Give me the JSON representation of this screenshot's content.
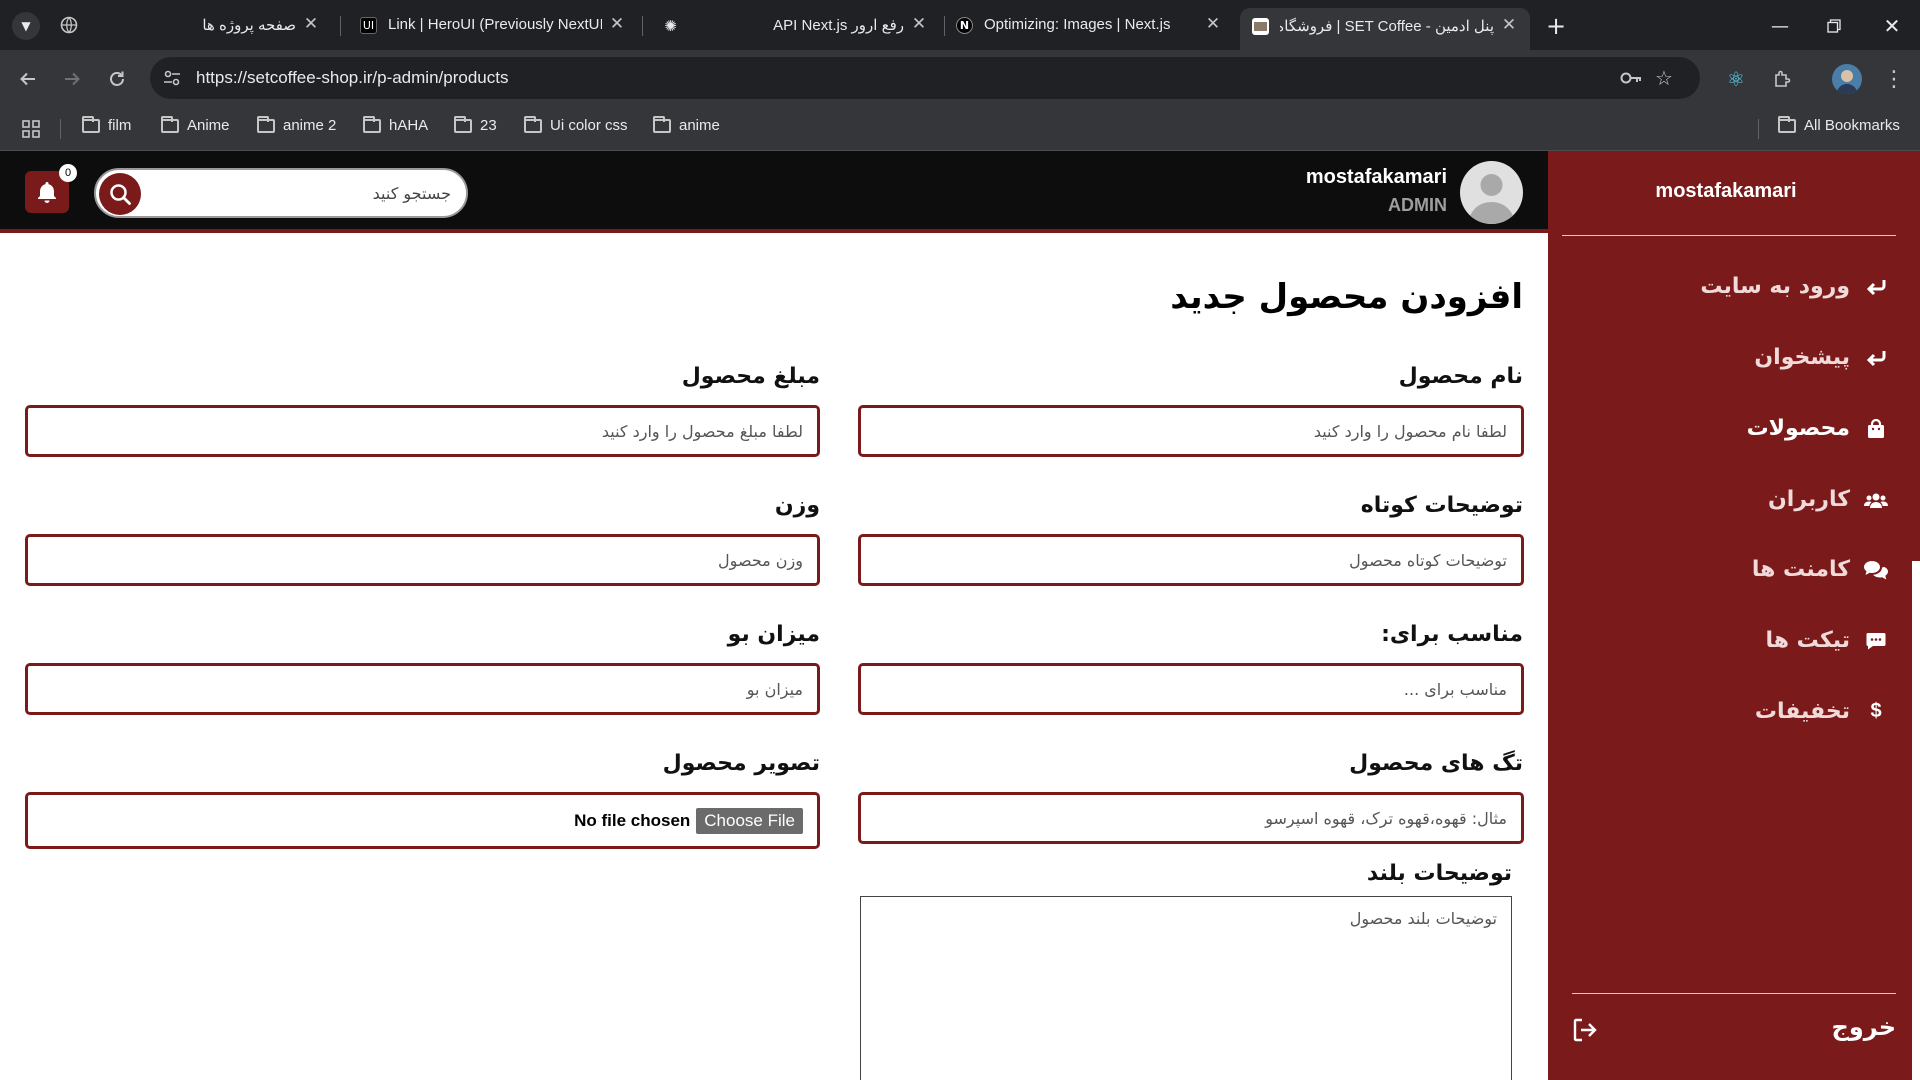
{
  "browser": {
    "tabs": [
      {
        "title": "صفحه پروژه ها",
        "favicon": "globe-icon",
        "rtl": true
      },
      {
        "title": "Link | HeroUI (Previously NextUI)",
        "favicon": "heroui-icon",
        "rtl": false
      },
      {
        "title": "رفع ارور API Next.js",
        "favicon": "chatgpt-icon",
        "rtl": true
      },
      {
        "title": "Optimizing: Images | Next.js",
        "favicon": "nextjs-icon",
        "rtl": false
      },
      {
        "title": "پنل ادمین - SET Coffee | فروشگاه",
        "favicon": "setcoffee-icon",
        "rtl": true,
        "active": true
      }
    ],
    "url": "https://setcoffee-shop.ir/p-admin/products",
    "bookmarks": [
      "film",
      "Anime",
      "anime 2",
      "hAHA",
      "23",
      "Ui color css",
      "anime"
    ],
    "all_bookmarks_label": "All Bookmarks"
  },
  "topbar": {
    "notification_count": "0",
    "search_placeholder": "جستجو کنید",
    "admin_name": "mostafakamari",
    "admin_role": "ADMIN"
  },
  "sidebar": {
    "username": "mostafakamari",
    "items": [
      {
        "label": "ورود به سایت",
        "icon": "reply-arrow-icon"
      },
      {
        "label": "پیشخوان",
        "icon": "reply-arrow-icon"
      },
      {
        "label": "محصولات",
        "icon": "shopping-bag-icon",
        "active": true
      },
      {
        "label": "کاربران",
        "icon": "users-icon"
      },
      {
        "label": "کامنت ها",
        "icon": "comments-icon"
      },
      {
        "label": "تیکت ها",
        "icon": "message-icon"
      },
      {
        "label": "تخفیفات",
        "icon": "dollar-icon"
      }
    ],
    "logout_label": "خروج"
  },
  "form": {
    "title": "افزودن محصول جدید",
    "fields": {
      "name": {
        "label": "نام محصول",
        "placeholder": "لطفا نام محصول را وارد کنید"
      },
      "price": {
        "label": "مبلغ محصول",
        "placeholder": "لطفا مبلغ محصول را وارد کنید"
      },
      "short_desc": {
        "label": "توضیحات کوتاه",
        "placeholder": "توضیحات کوتاه محصول"
      },
      "weight": {
        "label": "وزن",
        "placeholder": "وزن محصول"
      },
      "suitable_for": {
        "label": "مناسب برای:",
        "placeholder": "مناسب برای ..."
      },
      "smell": {
        "label": "میزان بو",
        "placeholder": "میزان بو"
      },
      "tags": {
        "label": "تگ های محصول",
        "placeholder": "مثال: قهوه،قهوه ترک، قهوه اسپرسو"
      },
      "image": {
        "label": "تصویر محصول",
        "button": "Choose File",
        "status": "No file chosen"
      },
      "long_desc": {
        "label": "توضیحات بلند",
        "placeholder": "توضیحات بلند محصول"
      }
    }
  },
  "colors": {
    "accent": "#7b1a1a",
    "topbar": "#0d0d0d"
  }
}
